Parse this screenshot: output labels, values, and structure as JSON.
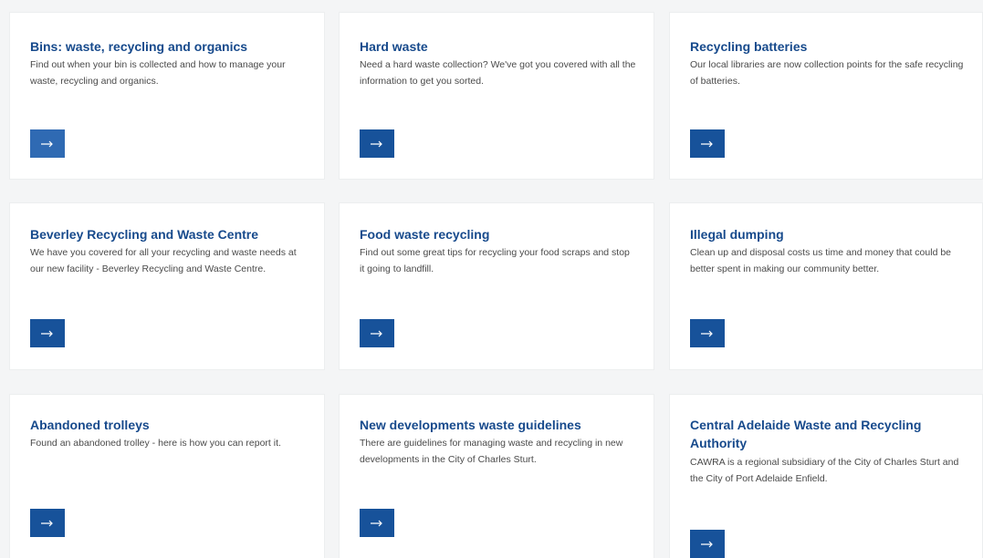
{
  "cards": [
    {
      "title": "Bins: waste, recycling and organics",
      "description": "Find out when your bin is collected and how to manage your waste, recycling and organics.",
      "button_icon": "arrow-right-icon"
    },
    {
      "title": "Hard waste",
      "description": "Need a hard waste collection? We've got you covered with all the information to get you sorted.",
      "button_icon": "arrow-right-icon"
    },
    {
      "title": "Recycling batteries",
      "description": "Our local libraries are now collection points for the safe recycling of batteries.",
      "button_icon": "arrow-right-icon"
    },
    {
      "title": "Beverley Recycling and Waste Centre",
      "description": "We have you covered for all your recycling and waste needs at our new facility - Beverley Recycling and Waste Centre.",
      "button_icon": "arrow-right-icon"
    },
    {
      "title": "Food waste recycling",
      "description": "Find out some great tips for recycling your food scraps and stop it going to landfill.",
      "button_icon": "arrow-right-icon"
    },
    {
      "title": "Illegal dumping",
      "description": "Clean up and disposal costs us time and money that could be better spent in making our community better.",
      "button_icon": "arrow-right-icon"
    },
    {
      "title": "Abandoned trolleys",
      "description": "Found an abandoned trolley - here is how you can report it.",
      "button_icon": "arrow-right-icon"
    },
    {
      "title": "New developments waste guidelines",
      "description": "There are guidelines for managing waste and recycling in new developments in the City of Charles Sturt.",
      "button_icon": "arrow-right-icon"
    },
    {
      "title": "Central Adelaide Waste and Recycling Authority",
      "description": "CAWRA is a regional subsidiary of the City of Charles Sturt and the City of Port Adelaide Enfield.",
      "button_icon": "arrow-right-icon"
    }
  ],
  "colors": {
    "title": "#174a8c",
    "button": "#17529a",
    "button_faded": "#2f6ab3",
    "text": "#4a4a4a",
    "card_bg": "#ffffff",
    "page_bg": "#f4f5f6"
  }
}
